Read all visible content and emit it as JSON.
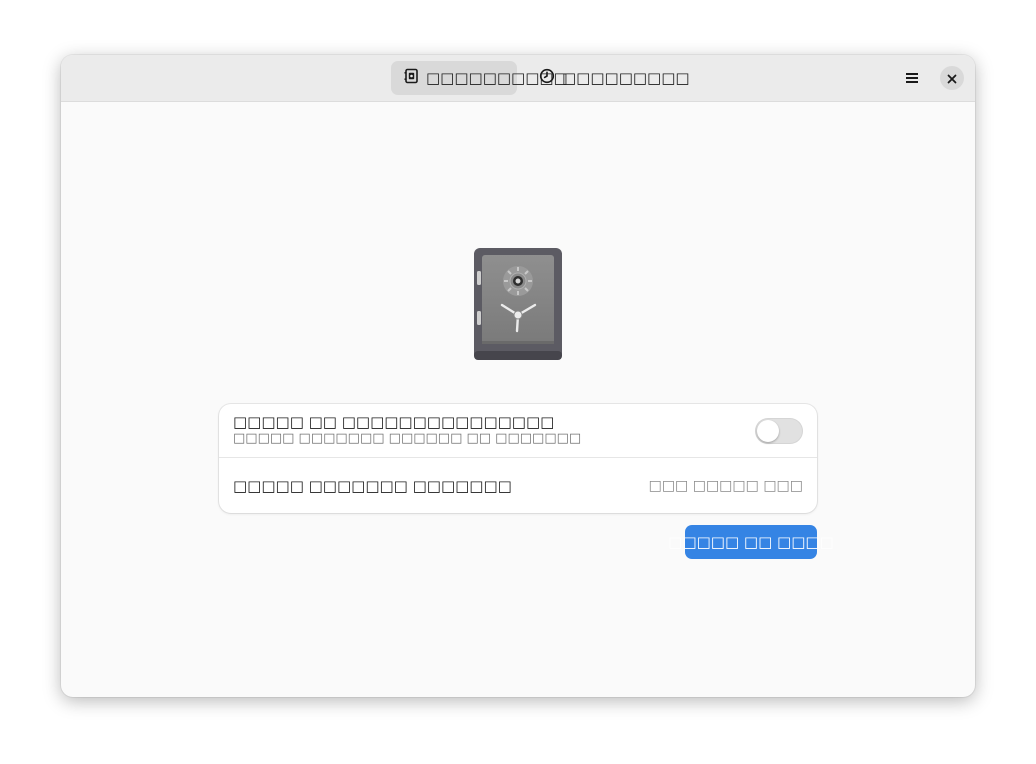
{
  "header": {
    "tabs": [
      {
        "label": "□□□□□□□□□□",
        "icon": "vault-icon",
        "active": true
      },
      {
        "label": "□□□□□□□□□",
        "icon": "clock-icon",
        "active": false
      }
    ],
    "menu_icon": "hamburger-menu-icon",
    "close_icon": "close-icon"
  },
  "main": {
    "illustration": "safe-icon",
    "settings": {
      "toggle_row": {
        "title": "□□□□□ □□ □□□□□□□□□□□□□□□",
        "subtitle": "□□□□□ □□□□□□□ □□□□□□ □□ □□□□□□□",
        "enabled": false
      },
      "value_row": {
        "title": "□□□□□ □□□□□□□ □□□□□□□",
        "value": "□□□ □□□□□ □□□"
      }
    },
    "primary_button": "□□□□□ □□ □□□□"
  },
  "colors": {
    "accent": "#3584e4",
    "headerbar": "#ebebeb",
    "window_bg": "#fafafa"
  }
}
